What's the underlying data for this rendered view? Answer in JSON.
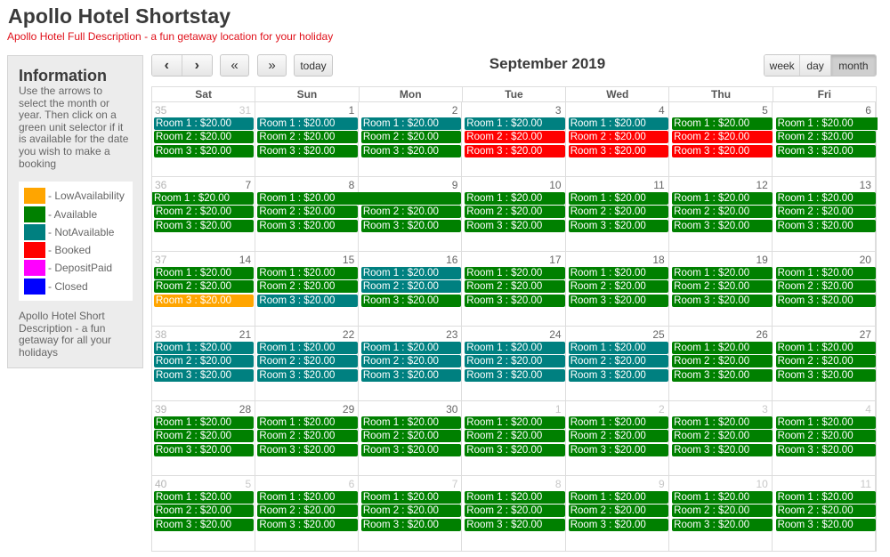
{
  "header": {
    "title": "Apollo Hotel Shortstay",
    "subtitle": "Apollo Hotel Full Description - a fun getaway location for your holiday"
  },
  "info": {
    "title": "Information",
    "text": "Use the arrows to select the month or year. Then click on a green unit selector if it is available for the date you wish to make a booking",
    "legend": [
      {
        "label": "- LowAvailability",
        "color": "#ffa500",
        "icon": "low-availability-swatch"
      },
      {
        "label": "- Available",
        "color": "#008000",
        "icon": "available-swatch"
      },
      {
        "label": "- NotAvailable",
        "color": "#008080",
        "icon": "not-available-swatch"
      },
      {
        "label": "- Booked",
        "color": "#ff0000",
        "icon": "booked-swatch"
      },
      {
        "label": "- DepositPaid",
        "color": "#ff00ff",
        "icon": "deposit-paid-swatch"
      },
      {
        "label": "- Closed",
        "color": "#0000ff",
        "icon": "closed-swatch"
      }
    ],
    "short_description": "Apollo Hotel Short Description - a fun getaway for all your holidays"
  },
  "toolbar": {
    "prev": "‹",
    "next": "›",
    "prev_year": "«",
    "next_year": "»",
    "today": "today",
    "title": "September 2019",
    "views": [
      {
        "label": "week",
        "active": false
      },
      {
        "label": "day",
        "active": false
      },
      {
        "label": "month",
        "active": true
      }
    ]
  },
  "colors": {
    "A": "#008000",
    "N": "#008080",
    "B": "#ff0000",
    "L": "#ffa500",
    "D": "#ff00ff",
    "C": "#0000ff"
  },
  "calendar": {
    "days_of_week": [
      "Sat",
      "Sun",
      "Mon",
      "Tue",
      "Wed",
      "Thu",
      "Fri"
    ],
    "event_label": "$20.00",
    "rooms": [
      "Room 1",
      "Room 2",
      "Room 3"
    ],
    "weeks": [
      {
        "week_number": "35",
        "days": [
          {
            "num": "31",
            "other": true,
            "status": [
              "N",
              "A",
              "A"
            ]
          },
          {
            "num": "1",
            "other": false,
            "status": [
              "N",
              "A",
              "A"
            ]
          },
          {
            "num": "2",
            "other": false,
            "status": [
              "N",
              "A",
              "A"
            ]
          },
          {
            "num": "3",
            "other": false,
            "status": [
              "N",
              "B",
              "B"
            ]
          },
          {
            "num": "4",
            "other": false,
            "status": [
              "N",
              "B",
              "B"
            ]
          },
          {
            "num": "5",
            "other": false,
            "status": [
              "A",
              "B",
              "B"
            ]
          },
          {
            "num": "6",
            "other": false,
            "status": [
              "A",
              "A",
              "A"
            ]
          }
        ],
        "spans": [
          {
            "room": 0,
            "start": 6,
            "end": 6,
            "open_left": false,
            "open_right": true
          }
        ]
      },
      {
        "week_number": "36",
        "days": [
          {
            "num": "7",
            "other": false,
            "status": [
              "A",
              "A",
              "A"
            ]
          },
          {
            "num": "8",
            "other": false,
            "status": [
              "A",
              "A",
              "A"
            ]
          },
          {
            "num": "9",
            "other": false,
            "status": [
              "A",
              "A",
              "A"
            ]
          },
          {
            "num": "10",
            "other": false,
            "status": [
              "A",
              "A",
              "A"
            ]
          },
          {
            "num": "11",
            "other": false,
            "status": [
              "A",
              "A",
              "A"
            ]
          },
          {
            "num": "12",
            "other": false,
            "status": [
              "A",
              "A",
              "A"
            ]
          },
          {
            "num": "13",
            "other": false,
            "status": [
              "A",
              "A",
              "A"
            ]
          }
        ],
        "spans": [
          {
            "room": 0,
            "start": 0,
            "end": 0,
            "open_left": true,
            "open_right": false
          },
          {
            "room": 0,
            "start": 1,
            "end": 2,
            "open_left": false,
            "open_right": false
          }
        ]
      },
      {
        "week_number": "37",
        "days": [
          {
            "num": "14",
            "other": false,
            "status": [
              "A",
              "A",
              "L"
            ]
          },
          {
            "num": "15",
            "other": false,
            "status": [
              "A",
              "A",
              "N"
            ]
          },
          {
            "num": "16",
            "other": false,
            "status": [
              "N",
              "N",
              "A"
            ]
          },
          {
            "num": "17",
            "other": false,
            "status": [
              "A",
              "A",
              "A"
            ]
          },
          {
            "num": "18",
            "other": false,
            "status": [
              "A",
              "A",
              "A"
            ]
          },
          {
            "num": "19",
            "other": false,
            "status": [
              "A",
              "A",
              "A"
            ]
          },
          {
            "num": "20",
            "other": false,
            "status": [
              "A",
              "A",
              "A"
            ]
          }
        ],
        "spans": []
      },
      {
        "week_number": "38",
        "days": [
          {
            "num": "21",
            "other": false,
            "status": [
              "N",
              "N",
              "N"
            ]
          },
          {
            "num": "22",
            "other": false,
            "status": [
              "N",
              "N",
              "N"
            ]
          },
          {
            "num": "23",
            "other": false,
            "status": [
              "N",
              "N",
              "N"
            ]
          },
          {
            "num": "24",
            "other": false,
            "status": [
              "N",
              "N",
              "N"
            ]
          },
          {
            "num": "25",
            "other": false,
            "status": [
              "N",
              "N",
              "N"
            ]
          },
          {
            "num": "26",
            "other": false,
            "status": [
              "A",
              "A",
              "A"
            ]
          },
          {
            "num": "27",
            "other": false,
            "status": [
              "A",
              "A",
              "A"
            ]
          }
        ],
        "spans": []
      },
      {
        "week_number": "39",
        "days": [
          {
            "num": "28",
            "other": false,
            "status": [
              "A",
              "A",
              "A"
            ]
          },
          {
            "num": "29",
            "other": false,
            "status": [
              "A",
              "A",
              "A"
            ]
          },
          {
            "num": "30",
            "other": false,
            "status": [
              "A",
              "A",
              "A"
            ]
          },
          {
            "num": "1",
            "other": true,
            "status": [
              "A",
              "A",
              "A"
            ]
          },
          {
            "num": "2",
            "other": true,
            "status": [
              "A",
              "A",
              "A"
            ]
          },
          {
            "num": "3",
            "other": true,
            "status": [
              "A",
              "A",
              "A"
            ]
          },
          {
            "num": "4",
            "other": true,
            "status": [
              "A",
              "A",
              "A"
            ]
          }
        ],
        "spans": []
      },
      {
        "week_number": "40",
        "days": [
          {
            "num": "5",
            "other": true,
            "status": [
              "A",
              "A",
              "A"
            ]
          },
          {
            "num": "6",
            "other": true,
            "status": [
              "A",
              "A",
              "A"
            ]
          },
          {
            "num": "7",
            "other": true,
            "status": [
              "A",
              "A",
              "A"
            ]
          },
          {
            "num": "8",
            "other": true,
            "status": [
              "A",
              "A",
              "A"
            ]
          },
          {
            "num": "9",
            "other": true,
            "status": [
              "A",
              "A",
              "A"
            ]
          },
          {
            "num": "10",
            "other": true,
            "status": [
              "A",
              "A",
              "A"
            ]
          },
          {
            "num": "11",
            "other": true,
            "status": [
              "A",
              "A",
              "A"
            ]
          }
        ],
        "spans": []
      }
    ]
  }
}
